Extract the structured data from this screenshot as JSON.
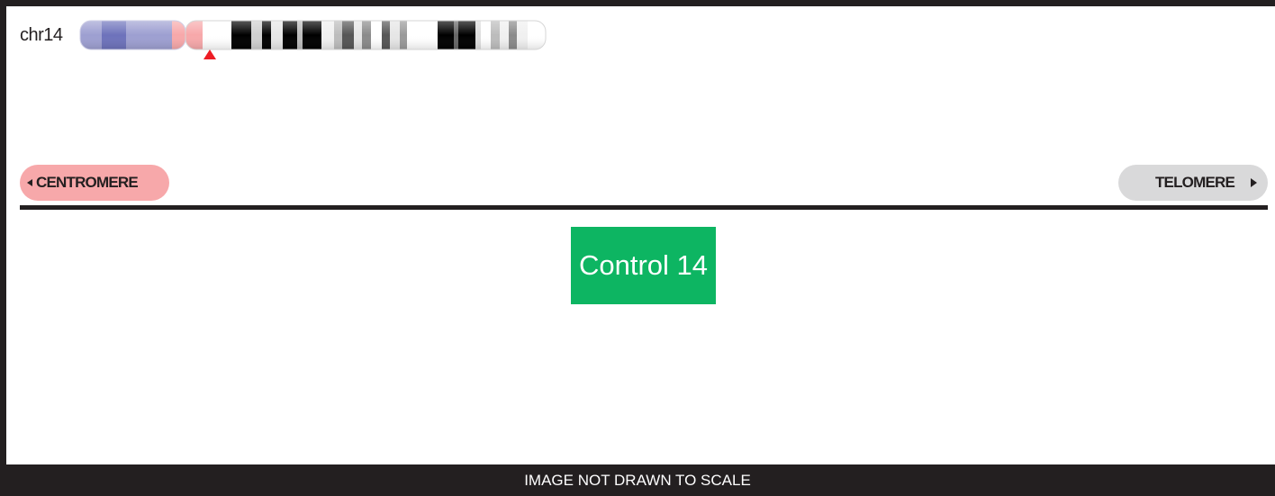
{
  "chromosome": {
    "label": "chr14",
    "p_arm_color": "#9d9fd1",
    "p_arm_band_color": "#6d72bb",
    "centromere_color": "#f7a8aa",
    "marker_color": "#ed1c24",
    "marker_icon": "red-triangle-marker-icon"
  },
  "orientation": {
    "centromere_label": "CENTROMERE",
    "centromere_color": "#f7a8aa",
    "telomere_label": "TELOMERE",
    "telomere_color": "#d9d9da"
  },
  "feature": {
    "label": "Control 14",
    "color": "#0db562"
  },
  "footer": {
    "text": "IMAGE NOT DRAWN TO SCALE"
  }
}
